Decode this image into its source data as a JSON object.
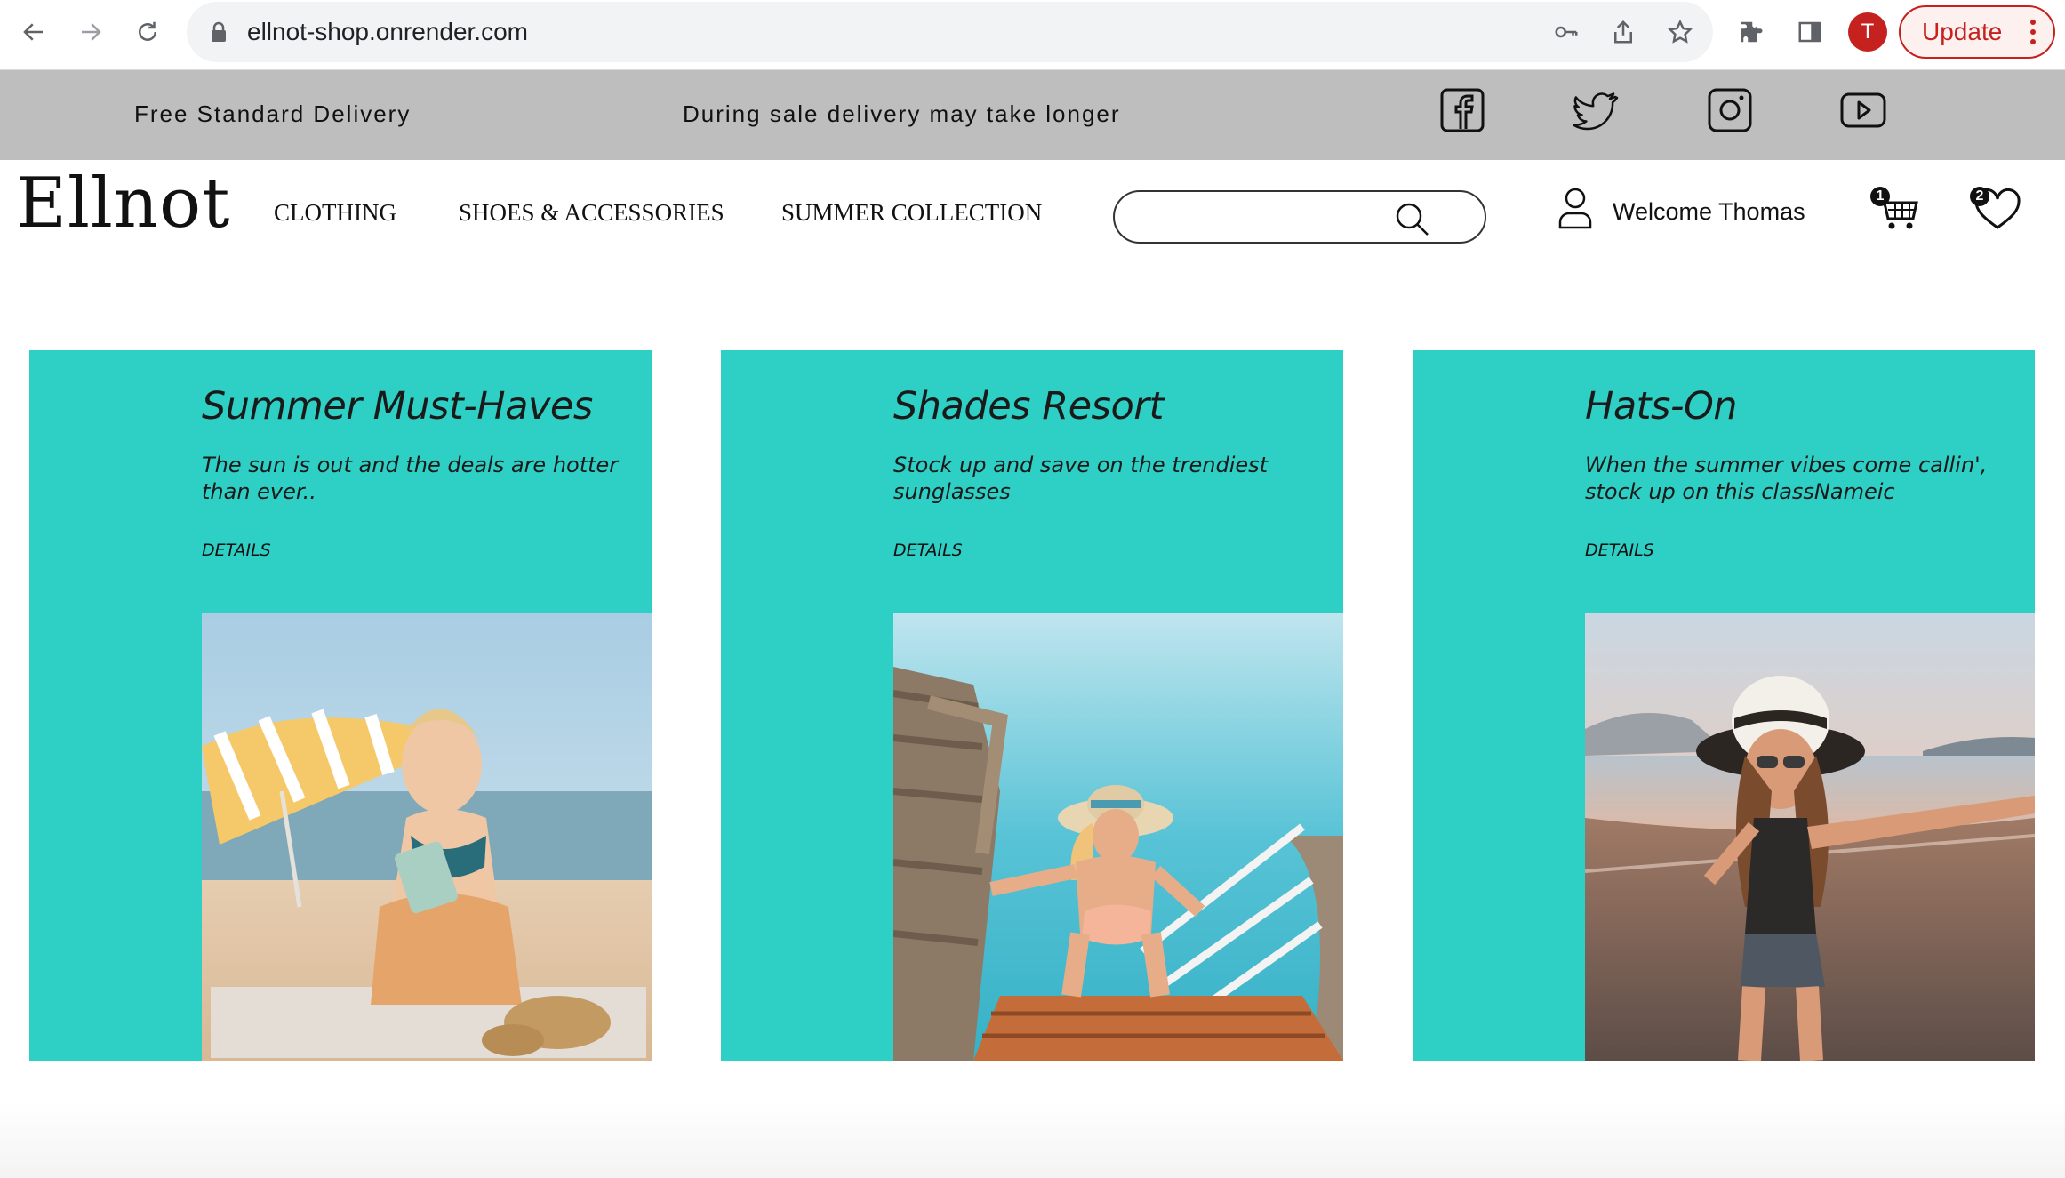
{
  "browser": {
    "url": "ellnot-shop.onrender.com",
    "profile_initial": "T",
    "update_label": "Update",
    "colors": {
      "profile": "#c5221f",
      "update": "#c5221f"
    }
  },
  "promo": {
    "left_text": "Free Standard Delivery",
    "center_text": "During sale delivery may take longer",
    "social_icons": [
      "facebook-icon",
      "twitter-icon",
      "instagram-icon",
      "youtube-icon"
    ],
    "background": "#bebebe"
  },
  "header": {
    "logo": "Ellnot",
    "menu": [
      "CLOTHING",
      "SHOES & ACCESSORIES",
      "SUMMER COLLECTION"
    ],
    "search_placeholder": "",
    "welcome": "Welcome Thomas",
    "cart_count": "1",
    "wishlist_count": "2"
  },
  "cards": [
    {
      "title": "Summer Must-Haves",
      "description": "The sun is out and the deals are hotter than ever..",
      "link": "DETAILS",
      "image": "beach-umbrella-photo"
    },
    {
      "title": "Shades Resort",
      "description": "Stock up and save on the trendiest sunglasses",
      "link": "DETAILS",
      "image": "pool-ladder-photo"
    },
    {
      "title": "Hats-On",
      "description": "When the summer vibes come callin', stock up on this classNameic",
      "link": "DETAILS",
      "image": "sunset-beach-photo"
    }
  ],
  "theme": {
    "card_background": "#2ecfc4"
  }
}
